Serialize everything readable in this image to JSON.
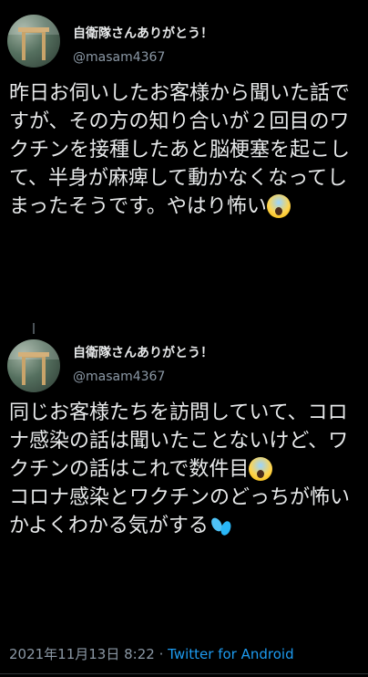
{
  "tweets": [
    {
      "name": "自衛隊さんありがとう！",
      "handle": "@masam4367",
      "text": "昨日お伺いしたお客様から聞いた話ですが、その方の知り合いが２回目のワクチンを接種したあと脳梗塞を起こして、半身が麻痺して動かなくなってしまったそうです。やはり怖い",
      "emoji_end": "face-screaming-in-fear-icon"
    },
    {
      "name": "自衛隊さんありがとう！",
      "handle": "@masam4367",
      "text_part1": "同じお客様たちを訪問していて、コロナ感染の話は聞いたことないけど、ワクチンの話はこれで数件目",
      "emoji_mid": "face-screaming-in-fear-icon",
      "text_part2": "コロナ感染とワクチンのどっちが怖いかよくわかる気がする",
      "emoji_end": "sweat-droplets-icon"
    }
  ],
  "footer": {
    "timestamp": "2021年11月13日 8:22",
    "separator": "·",
    "source": "Twitter for Android"
  }
}
